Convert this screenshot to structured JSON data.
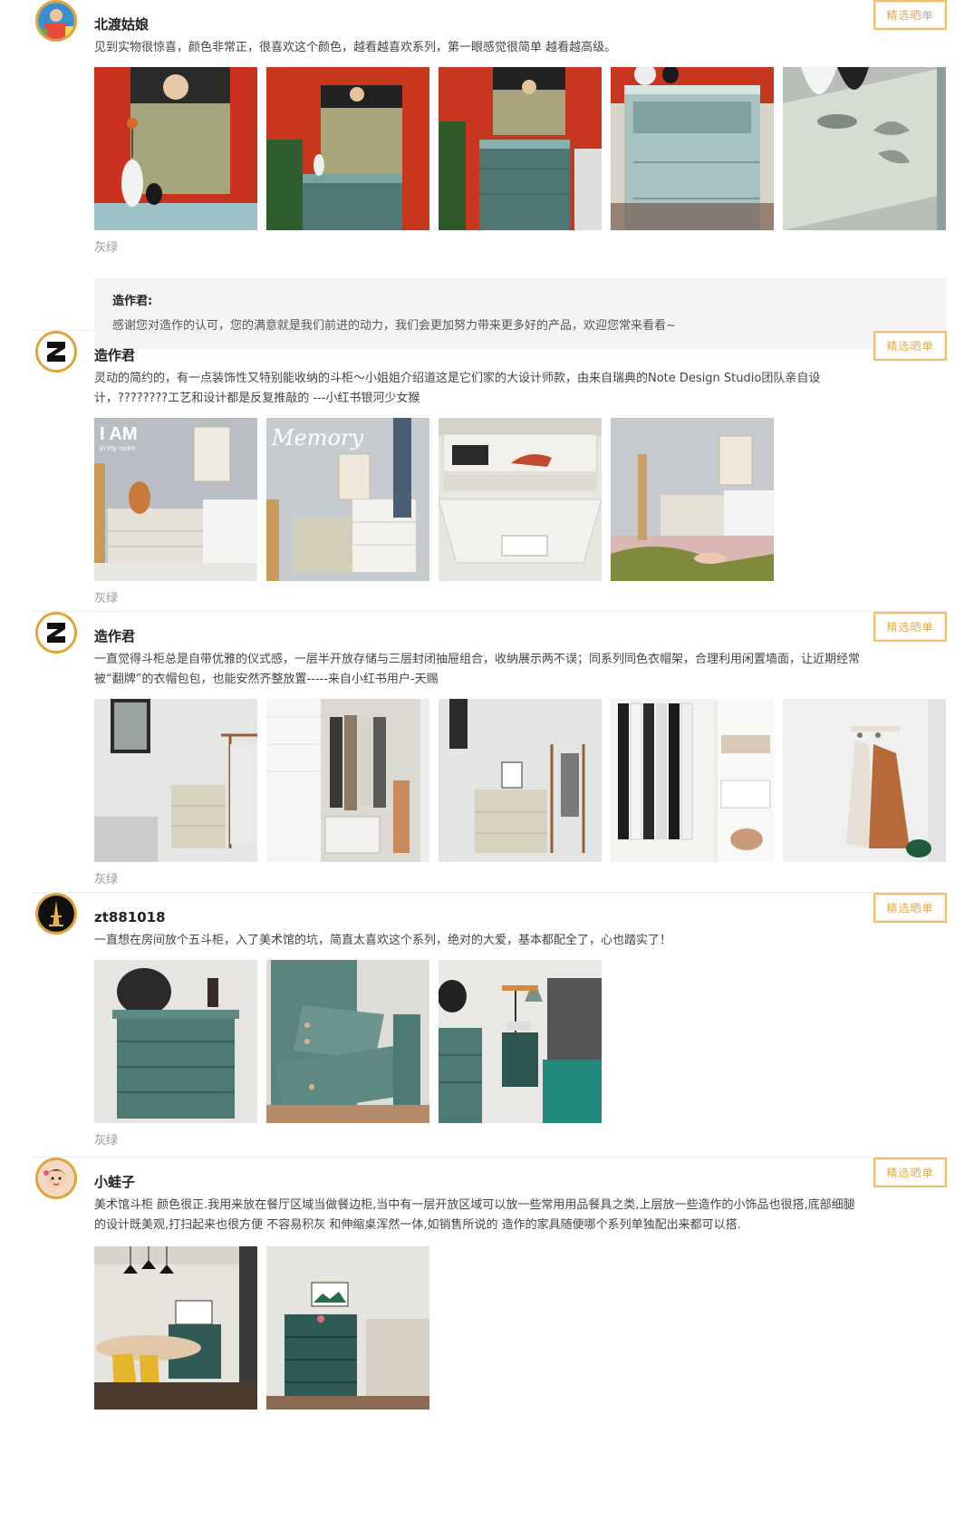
{
  "badge_label": "精选晒单",
  "reviews": [
    {
      "name": "北渡姑娘",
      "text": "见到实物很惊喜，颜色非常正，很喜欢这个颜色，越看越喜欢系列，第一眼感觉很简单 越看越高级。",
      "spec": "灰绿",
      "reply": {
        "name": "造作君:",
        "text": "感谢您对造作的认可，您的满意就是我们前进的动力，我们会更加努力带来更多好的产品，欢迎您常来看看~"
      }
    },
    {
      "name": "造作君",
      "text": "灵动的简约的，有一点装饰性又特别能收纳的斗柜～小姐姐介绍道这是它们家的大设计师款，由来自瑞典的Note Design Studio团队亲自设计，????????工艺和设计都是反复推敲的 ---小红书银河少女猴",
      "spec": "灰绿",
      "photo_captions": [
        "I AM",
        "in my room",
        "Memory"
      ]
    },
    {
      "name": "造作君",
      "text": "一直觉得斗柜总是自带优雅的仪式感，一层半开放存储与三层封闭抽屉组合，收纳展示两不误；同系列同色衣帽架，合理利用闲置墙面，让近期经常被“翻牌”的衣帽包包，也能安然齐整放置-----来自小红书用户-天赐",
      "spec": "灰绿"
    },
    {
      "name": "zt881018",
      "text": "一直想在房间放个五斗柜，入了美术馆的坑，简直太喜欢这个系列，绝对的大爱，基本都配全了，心也踏实了！",
      "spec": "灰绿"
    },
    {
      "name": "小蛙子",
      "text": "美术馆斗柜 颜色很正.我用来放在餐厅区域当做餐边柜,当中有一层开放区域可以放一些常用用品餐具之类,上层放一些造作的小饰品也很搭,底部细腿的设计既美观,打扫起来也很方便 不容易积灰 和伸缩桌浑然一体,如销售所说的 造作的家具随便哪个系列单独配出来都可以搭."
    }
  ]
}
